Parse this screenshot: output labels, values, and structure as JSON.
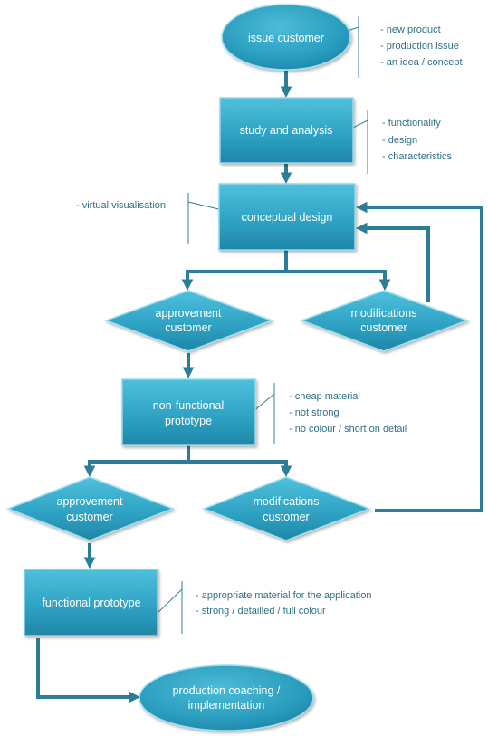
{
  "diagram": {
    "type": "flowchart",
    "colors": {
      "node_fill_top": "#4fc0dc",
      "node_fill_bottom": "#1f8aab",
      "node_edge_light": "#a8e6f4",
      "connector": "#2c7d98",
      "note_text": "#2f6f86"
    },
    "nodes": {
      "issue_customer": {
        "shape": "ellipse",
        "lines": [
          "issue customer"
        ]
      },
      "study_analysis": {
        "shape": "rectangle",
        "lines": [
          "study and analysis"
        ]
      },
      "conceptual_design": {
        "shape": "rectangle",
        "lines": [
          "conceptual design"
        ]
      },
      "approvement_1": {
        "shape": "diamond",
        "lines": [
          "approvement",
          "customer"
        ]
      },
      "modifications_1": {
        "shape": "diamond",
        "lines": [
          "modifications",
          "customer"
        ]
      },
      "non_functional": {
        "shape": "rectangle",
        "lines": [
          "non-functional",
          "prototype"
        ]
      },
      "approvement_2": {
        "shape": "diamond",
        "lines": [
          "approvement",
          "customer"
        ]
      },
      "modifications_2": {
        "shape": "diamond",
        "lines": [
          "modifications",
          "customer"
        ]
      },
      "functional": {
        "shape": "rectangle",
        "lines": [
          "functional  prototype"
        ]
      },
      "production": {
        "shape": "ellipse",
        "lines": [
          "production coaching /",
          "implementation"
        ]
      }
    },
    "notes": {
      "issue_customer": [
        "- new product",
        "- production issue",
        "- an idea / concept"
      ],
      "study_analysis": [
        "- functionality",
        "- design",
        "- characteristics"
      ],
      "conceptual_design": [
        "- virtual visualisation"
      ],
      "non_functional": [
        "- cheap material",
        "- not strong",
        "- no colour / short on detail"
      ],
      "functional": [
        "- appropriate material for the application",
        "- strong / detailled / full colour"
      ]
    },
    "edges": [
      {
        "from": "issue_customer",
        "to": "study_analysis"
      },
      {
        "from": "study_analysis",
        "to": "conceptual_design"
      },
      {
        "from": "conceptual_design",
        "to": "approvement_1"
      },
      {
        "from": "conceptual_design",
        "to": "modifications_1"
      },
      {
        "from": "modifications_1",
        "to": "conceptual_design"
      },
      {
        "from": "approvement_1",
        "to": "non_functional"
      },
      {
        "from": "non_functional",
        "to": "approvement_2"
      },
      {
        "from": "non_functional",
        "to": "modifications_2"
      },
      {
        "from": "modifications_2",
        "to": "conceptual_design"
      },
      {
        "from": "approvement_2",
        "to": "functional"
      },
      {
        "from": "functional",
        "to": "production"
      }
    ]
  }
}
